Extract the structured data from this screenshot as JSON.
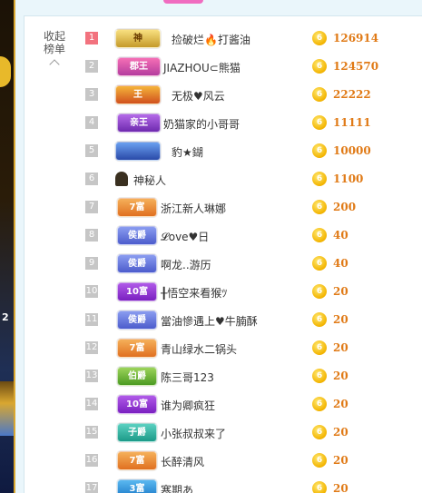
{
  "panel": {
    "collapse_line1": "收起",
    "collapse_line2": "榜单"
  },
  "coin_symbol": "6",
  "rows": [
    {
      "rank": "1",
      "badge": "神",
      "name": "捡破烂🔥打酱油",
      "amount": "126914"
    },
    {
      "rank": "2",
      "badge": "郡王",
      "name": "JIAZHOU⊂熊猫",
      "amount": "124570"
    },
    {
      "rank": "3",
      "badge": "王",
      "name": "无极♥风云",
      "amount": "22222"
    },
    {
      "rank": "4",
      "badge": "亲王",
      "name": "奶猫家的小哥哥",
      "amount": "11111"
    },
    {
      "rank": "5",
      "badge": "",
      "name": "豹★鍸",
      "amount": "10000"
    },
    {
      "rank": "6",
      "badge": "",
      "name": "神秘人",
      "amount": "1100"
    },
    {
      "rank": "7",
      "badge": "7富",
      "name": "浙江新人琳娜",
      "amount": "200"
    },
    {
      "rank": "8",
      "badge": "侯爵",
      "name": "𝓛ove♥日",
      "amount": "40"
    },
    {
      "rank": "9",
      "badge": "侯爵",
      "name": "啊龙..游历",
      "amount": "40"
    },
    {
      "rank": "10",
      "badge": "10富",
      "name": "╂悟空来看猴ﾂ",
      "amount": "20"
    },
    {
      "rank": "11",
      "badge": "侯爵",
      "name": "當油慘遇上♥牛腩酥",
      "amount": "20"
    },
    {
      "rank": "12",
      "badge": "7富",
      "name": "青山绿水二锅头",
      "amount": "20"
    },
    {
      "rank": "13",
      "badge": "伯爵",
      "name": "陈三哥123",
      "amount": "20"
    },
    {
      "rank": "14",
      "badge": "10富",
      "name": "谁为卿疯狂",
      "amount": "20"
    },
    {
      "rank": "15",
      "badge": "子爵",
      "name": "小张叔叔来了",
      "amount": "20"
    },
    {
      "rank": "16",
      "badge": "7富",
      "name": "长醉清风",
      "amount": "20"
    },
    {
      "rank": "17",
      "badge": "3富",
      "name": "寒期あ",
      "amount": "20"
    }
  ]
}
